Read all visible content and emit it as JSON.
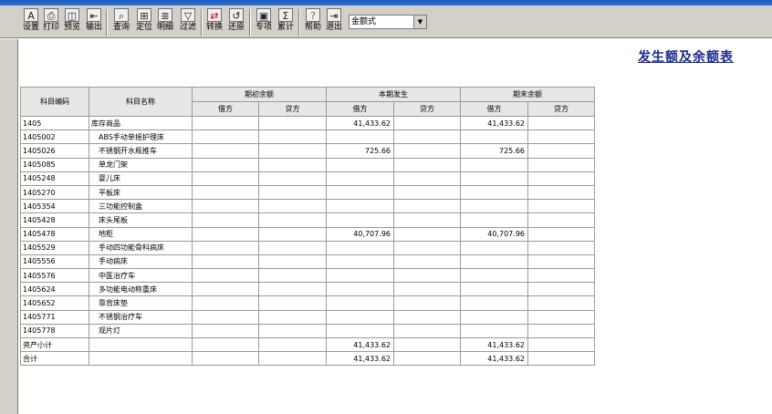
{
  "toolbar": {
    "items": [
      {
        "label": "设置",
        "glyph": "A"
      },
      {
        "label": "打印",
        "glyph": "⎙"
      },
      {
        "label": "预览",
        "glyph": "◫"
      },
      {
        "label": "输出",
        "glyph": "⇤"
      },
      {
        "label": "查询",
        "glyph": "⌕"
      },
      {
        "label": "定位",
        "glyph": "⊞"
      },
      {
        "label": "明细",
        "glyph": "≣"
      },
      {
        "label": "过滤",
        "glyph": "▽"
      },
      {
        "label": "转换",
        "glyph": "⇄"
      },
      {
        "label": "还原",
        "glyph": "↺"
      },
      {
        "label": "专项",
        "glyph": "▣"
      },
      {
        "label": "累计",
        "glyph": "Σ"
      },
      {
        "label": "帮助",
        "glyph": "?"
      },
      {
        "label": "退出",
        "glyph": "⇥"
      }
    ],
    "format_select": {
      "value": "金额式"
    }
  },
  "report": {
    "title": "发生额及余额表",
    "headers": {
      "code": "科目编码",
      "name": "科目名称",
      "opening": "期初余额",
      "period": "本期发生",
      "closing": "期末余额",
      "debit": "借方",
      "credit": "贷方"
    },
    "rows": [
      {
        "code": "1405",
        "name": "库存商品",
        "open_debit": "",
        "open_credit": "",
        "period_debit": "41,433.62",
        "period_credit": "",
        "close_debit": "41,433.62",
        "close_credit": ""
      },
      {
        "code": "1405002",
        "name": "ABS手动单摇护理床",
        "open_debit": "",
        "open_credit": "",
        "period_debit": "",
        "period_credit": "",
        "close_debit": "",
        "close_credit": ""
      },
      {
        "code": "1405026",
        "name": "不锈钢开水瓶推车",
        "open_debit": "",
        "open_credit": "",
        "period_debit": "725.66",
        "period_credit": "",
        "close_debit": "725.66",
        "close_credit": ""
      },
      {
        "code": "1405085",
        "name": "单龙门架",
        "open_debit": "",
        "open_credit": "",
        "period_debit": "",
        "period_credit": "",
        "close_debit": "",
        "close_credit": ""
      },
      {
        "code": "1405248",
        "name": "婴儿床",
        "open_debit": "",
        "open_credit": "",
        "period_debit": "",
        "period_credit": "",
        "close_debit": "",
        "close_credit": ""
      },
      {
        "code": "1405270",
        "name": "平板床",
        "open_debit": "",
        "open_credit": "",
        "period_debit": "",
        "period_credit": "",
        "close_debit": "",
        "close_credit": ""
      },
      {
        "code": "1405354",
        "name": "三功能控制盒",
        "open_debit": "",
        "open_credit": "",
        "period_debit": "",
        "period_credit": "",
        "close_debit": "",
        "close_credit": ""
      },
      {
        "code": "1405428",
        "name": "床头尾板",
        "open_debit": "",
        "open_credit": "",
        "period_debit": "",
        "period_credit": "",
        "close_debit": "",
        "close_credit": ""
      },
      {
        "code": "1405478",
        "name": "地柜",
        "open_debit": "",
        "open_credit": "",
        "period_debit": "40,707.96",
        "period_credit": "",
        "close_debit": "40,707.96",
        "close_credit": ""
      },
      {
        "code": "1405529",
        "name": "手动四功能骨科病床",
        "open_debit": "",
        "open_credit": "",
        "period_debit": "",
        "period_credit": "",
        "close_debit": "",
        "close_credit": ""
      },
      {
        "code": "1405556",
        "name": "手动病床",
        "open_debit": "",
        "open_credit": "",
        "period_debit": "",
        "period_credit": "",
        "close_debit": "",
        "close_credit": ""
      },
      {
        "code": "1405576",
        "name": "中医治疗车",
        "open_debit": "",
        "open_credit": "",
        "period_debit": "",
        "period_credit": "",
        "close_debit": "",
        "close_credit": ""
      },
      {
        "code": "1405624",
        "name": "多功能电动称重床",
        "open_debit": "",
        "open_credit": "",
        "period_debit": "",
        "period_credit": "",
        "close_debit": "",
        "close_credit": ""
      },
      {
        "code": "1405652",
        "name": "靠背床垫",
        "open_debit": "",
        "open_credit": "",
        "period_debit": "",
        "period_credit": "",
        "close_debit": "",
        "close_credit": ""
      },
      {
        "code": "1405771",
        "name": "不锈钢治疗车",
        "open_debit": "",
        "open_credit": "",
        "period_debit": "",
        "period_credit": "",
        "close_debit": "",
        "close_credit": ""
      },
      {
        "code": "1405778",
        "name": "观片灯",
        "open_debit": "",
        "open_credit": "",
        "period_debit": "",
        "period_credit": "",
        "close_debit": "",
        "close_credit": ""
      }
    ],
    "subtotal": {
      "label": "资产小计",
      "period_debit": "41,433.62",
      "close_debit": "41,433.62"
    },
    "total": {
      "label": "合计",
      "period_debit": "41,433.62",
      "close_debit": "41,433.62"
    }
  }
}
